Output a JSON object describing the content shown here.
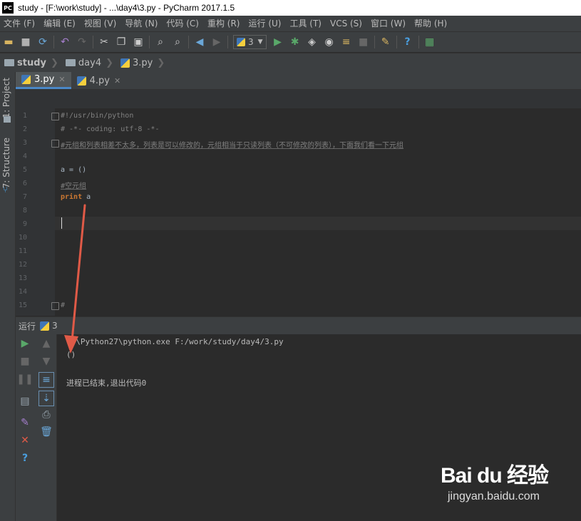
{
  "window": {
    "title": "study - [F:\\work\\study] - ...\\day4\\3.py - PyCharm 2017.1.5",
    "logo": "PC"
  },
  "menu": [
    "文件 (F)",
    "编辑 (E)",
    "视图 (V)",
    "导航 (N)",
    "代码 (C)",
    "重构 (R)",
    "运行 (U)",
    "工具 (T)",
    "VCS (S)",
    "窗口 (W)",
    "帮助 (H)"
  ],
  "toolbar": {
    "run_config": "3"
  },
  "breadcrumb": [
    "study",
    "day4",
    "3.py"
  ],
  "sidebar": {
    "project_tab": "1: Project",
    "structure_tab": "7: Structure"
  },
  "tabs": [
    {
      "label": "3.py",
      "active": true
    },
    {
      "label": "4.py",
      "active": false
    }
  ],
  "editor": {
    "line_numbers": [
      "1",
      "2",
      "3",
      "4",
      "5",
      "6",
      "7",
      "8",
      "9",
      "10",
      "11",
      "12",
      "13",
      "14",
      "15"
    ],
    "lines": {
      "l1": "#!/usr/bin/python",
      "l2": "# -*- coding: utf-8 -*-",
      "l3": "#元组和列表相差不太多，列表是可以修改的，元组相当于只读列表（不可修改的列表），下面我们看一下元组",
      "l5": "a = ()",
      "l6": "#空元组",
      "l7_kw": "print",
      "l7_rest": " a",
      "l15": "#"
    }
  },
  "run": {
    "header_label": "运行",
    "config": "3",
    "console": {
      "cmd": "C:\\Python27\\python.exe F:/work/study/day4/3.py",
      "output": "()",
      "exit": "进程已结束,退出代码0"
    }
  },
  "watermark": {
    "brand": "Bai du 经验",
    "site": "jingyan.baidu.com"
  },
  "colors": {
    "accent": "#4a88c7",
    "comment": "#808080",
    "keyword": "#cc7832",
    "arrow": "#e05a47"
  }
}
